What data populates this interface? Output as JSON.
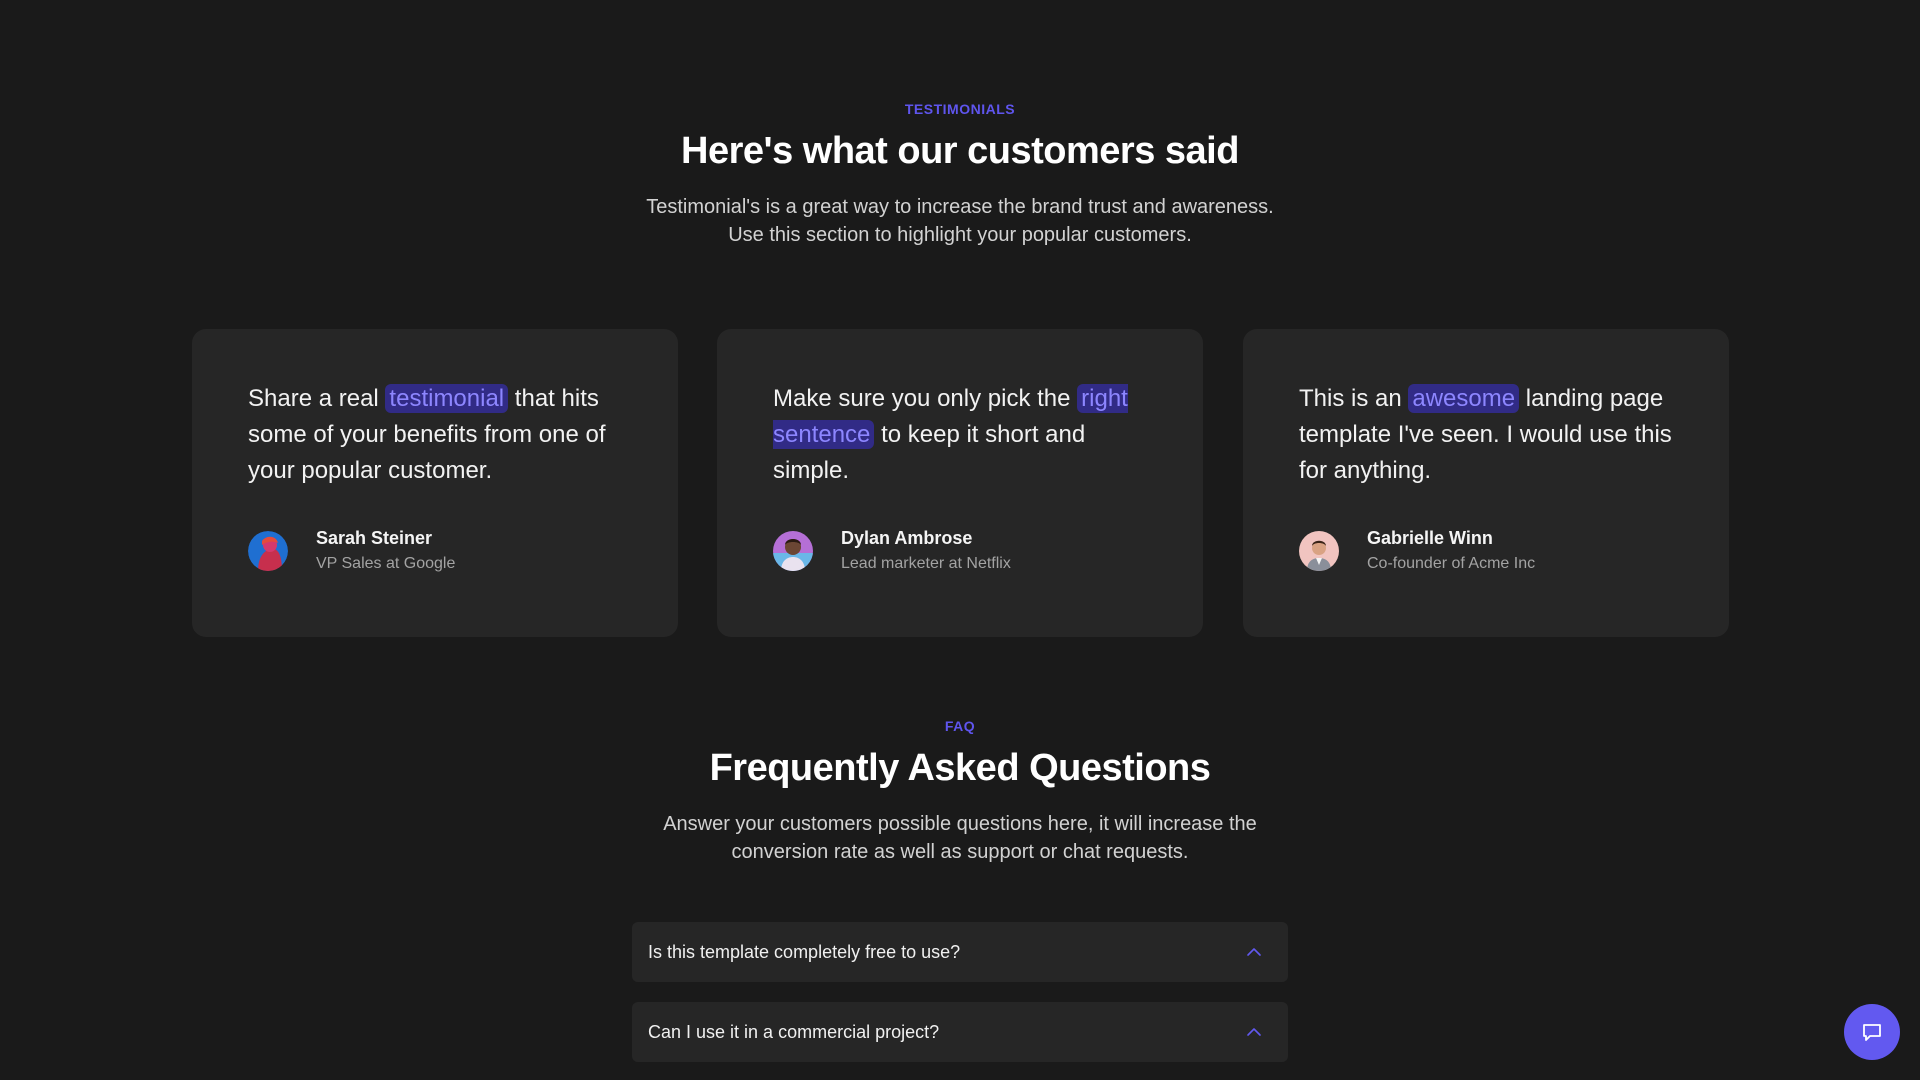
{
  "testimonials": {
    "eyebrow": "TESTIMONIALS",
    "title": "Here's what our customers said",
    "subtitle_line1": "Testimonial's is a great way to increase the brand trust and awareness.",
    "subtitle_line2": "Use this section to highlight your popular customers.",
    "cards": [
      {
        "quote_before": "Share a real ",
        "quote_highlight": "testimonial",
        "quote_after": " that hits some of your benefits from one of your popular customer.",
        "name": "Sarah Steiner",
        "role": "VP Sales at Google"
      },
      {
        "quote_before": "Make sure you only pick the ",
        "quote_highlight": "right sentence",
        "quote_after": " to keep it short and simple.",
        "name": "Dylan Ambrose",
        "role": "Lead marketer at Netflix"
      },
      {
        "quote_before": "This is an ",
        "quote_highlight": "awesome",
        "quote_after": " landing page template I've seen. I would use this for anything.",
        "name": "Gabrielle Winn",
        "role": "Co-founder of Acme Inc"
      }
    ]
  },
  "faq": {
    "eyebrow": "FAQ",
    "title": "Frequently Asked Questions",
    "subtitle_line1": "Answer your customers possible questions here, it will increase the",
    "subtitle_line2": "conversion rate as well as support or chat requests.",
    "items": [
      {
        "question": "Is this template completely free to use?",
        "icon": "chevron-up-icon"
      },
      {
        "question": "Can I use it in a commercial project?",
        "icon": "chevron-up-icon"
      }
    ]
  },
  "chat": {
    "icon": "chat-bubble-icon"
  },
  "colors": {
    "background": "#1a1a1a",
    "card": "#262626",
    "accent": "#5f55ee",
    "highlight_bg": "#312b86",
    "highlight_text": "#8d86ff"
  }
}
